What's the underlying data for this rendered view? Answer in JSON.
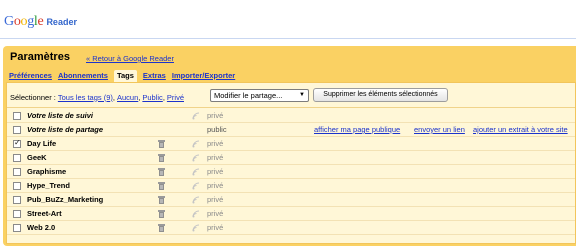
{
  "header": {
    "logo_google": "Google",
    "logo_reader": "Reader"
  },
  "settings": {
    "title": "Paramètres",
    "back_link": "« Retour à Google Reader"
  },
  "tabs": [
    {
      "label": "Préférences",
      "active": false
    },
    {
      "label": "Abonnements",
      "active": false
    },
    {
      "label": "Tags",
      "active": true
    },
    {
      "label": "Extras",
      "active": false
    },
    {
      "label": "Importer/Exporter",
      "active": false
    }
  ],
  "selection": {
    "label": "Sélectionner :",
    "all": "Tous les tags (9)",
    "none": "Aucun",
    "public": "Public",
    "private": "Privé",
    "dropdown_value": "Modifier le partage...",
    "delete_button": "Supprimer les éléments sélectionnés"
  },
  "tag_rows": [
    {
      "name": "Votre liste de suivi",
      "status": "privé",
      "checked": false,
      "italic": true,
      "deletable": false
    },
    {
      "name": "Votre liste de partage",
      "status": "public",
      "checked": false,
      "italic": true,
      "deletable": false,
      "links": [
        "afficher ma page publique",
        "envoyer un lien",
        "ajouter un extrait à votre site"
      ]
    },
    {
      "name": "Day Life",
      "status": "privé",
      "checked": true,
      "italic": false,
      "deletable": true
    },
    {
      "name": "GeeK",
      "status": "privé",
      "checked": false,
      "italic": false,
      "deletable": true
    },
    {
      "name": "Graphisme",
      "status": "privé",
      "checked": false,
      "italic": false,
      "deletable": true
    },
    {
      "name": "Hype_Trend",
      "status": "privé",
      "checked": false,
      "italic": false,
      "deletable": true
    },
    {
      "name": "Pub_BuZz_Marketing",
      "status": "privé",
      "checked": false,
      "italic": false,
      "deletable": true
    },
    {
      "name": "Street-Art",
      "status": "privé",
      "checked": false,
      "italic": false,
      "deletable": true
    },
    {
      "name": "Web 2.0",
      "status": "privé",
      "checked": false,
      "italic": false,
      "deletable": true
    }
  ],
  "colors": {
    "panel_bg": "#fad163",
    "content_bg": "#fff7d7",
    "link": "#1c33cc"
  }
}
